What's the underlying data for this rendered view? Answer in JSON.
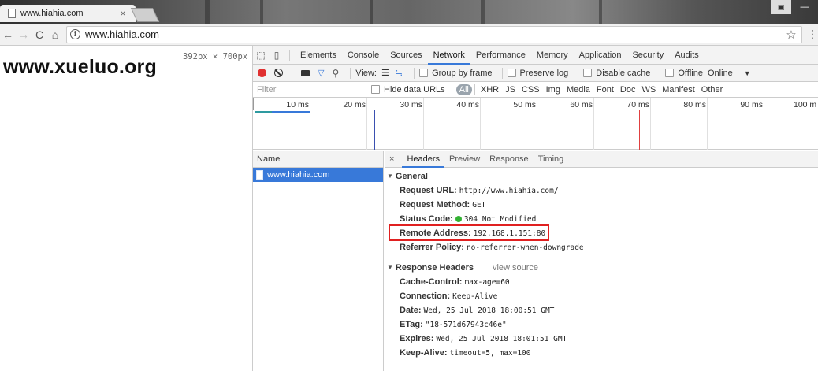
{
  "browser": {
    "tab_title": "www.hiahia.com",
    "tab_close": "×",
    "url": "www.hiahia.com"
  },
  "page": {
    "site_title": "www.xueluo.org",
    "dimensions": "392px × 700px"
  },
  "devtools": {
    "tabs": [
      "Elements",
      "Console",
      "Sources",
      "Network",
      "Performance",
      "Memory",
      "Application",
      "Security",
      "Audits"
    ],
    "active_tab": "Network",
    "toolbar": {
      "view_label": "View:",
      "group_by_frame": "Group by frame",
      "preserve_log": "Preserve log",
      "disable_cache": "Disable cache",
      "offline": "Offline",
      "online": "Online"
    },
    "filter": {
      "placeholder": "Filter",
      "hide_data_urls": "Hide data URLs",
      "types": [
        "All",
        "XHR",
        "JS",
        "CSS",
        "Img",
        "Media",
        "Font",
        "Doc",
        "WS",
        "Manifest",
        "Other"
      ]
    },
    "timeline_ticks": [
      "10 ms",
      "20 ms",
      "30 ms",
      "40 ms",
      "50 ms",
      "60 ms",
      "70 ms",
      "80 ms",
      "90 ms",
      "100 m"
    ],
    "name_header": "Name",
    "requests": [
      {
        "name": "www.hiahia.com"
      }
    ],
    "detail_tabs": [
      "Headers",
      "Preview",
      "Response",
      "Timing"
    ],
    "detail_close": "×",
    "general": {
      "title": "General",
      "request_url_label": "Request URL:",
      "request_url": "http://www.hiahia.com/",
      "method_label": "Request Method:",
      "method": "GET",
      "status_label": "Status Code:",
      "status": "304 Not Modified",
      "remote_label": "Remote Address:",
      "remote": "192.168.1.151:80",
      "referrer_label": "Referrer Policy:",
      "referrer": "no-referrer-when-downgrade"
    },
    "response_headers": {
      "title": "Response Headers",
      "view_source": "view source",
      "items": [
        {
          "key": "Cache-Control:",
          "value": "max-age=60"
        },
        {
          "key": "Connection:",
          "value": "Keep-Alive"
        },
        {
          "key": "Date:",
          "value": "Wed, 25 Jul 2018 18:00:51 GMT"
        },
        {
          "key": "ETag:",
          "value": "\"18-571d67943c46e\""
        },
        {
          "key": "Expires:",
          "value": "Wed, 25 Jul 2018 18:01:51 GMT"
        },
        {
          "key": "Keep-Alive:",
          "value": "timeout=5, max=100"
        }
      ]
    }
  },
  "colors": {
    "accent": "#3879d9",
    "record": "#e03030",
    "status_ok": "#33b233",
    "highlight": "#e02020"
  }
}
